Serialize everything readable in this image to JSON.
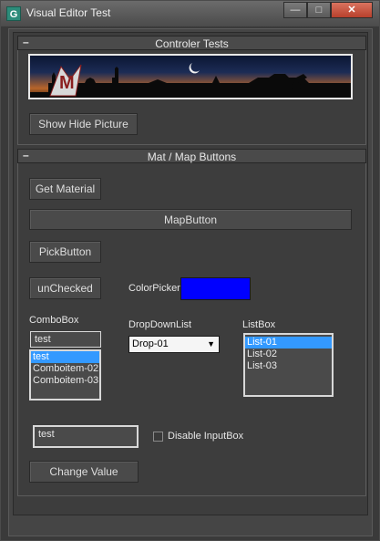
{
  "window": {
    "title": "Visual Editor Test",
    "icon_letter": "G",
    "min_symbol": "—",
    "max_symbol": "□",
    "close_symbol": "✕"
  },
  "rollouts": {
    "controler_tests": {
      "toggle": "–",
      "title": "Controler Tests"
    },
    "mat_map_buttons": {
      "toggle": "–",
      "title": "Mat / Map Buttons"
    }
  },
  "controls": {
    "show_hide_picture": "Show Hide Picture",
    "get_material": "Get Material",
    "map_button": "MapButton",
    "pick_button": "PickButton",
    "unchecked": "unChecked",
    "colorpicker_label": "ColorPicker",
    "colorpicker_value": "#0000ff",
    "combobox_label": "ComboBox",
    "combobox_text": "test",
    "combobox_items": [
      "test",
      "Comboitem-02",
      "Comboitem-03"
    ],
    "dropdown_label": "DropDownList",
    "dropdown_value": "Drop-01",
    "listbox_label": "ListBox",
    "listbox_items": [
      "List-01",
      "List-02",
      "List-03"
    ],
    "inputbox_value": "test",
    "disable_inputbox_label": "Disable InputBox",
    "disable_inputbox_checked": false,
    "change_value": "Change Value"
  },
  "banner": {
    "logo_text": "M"
  }
}
